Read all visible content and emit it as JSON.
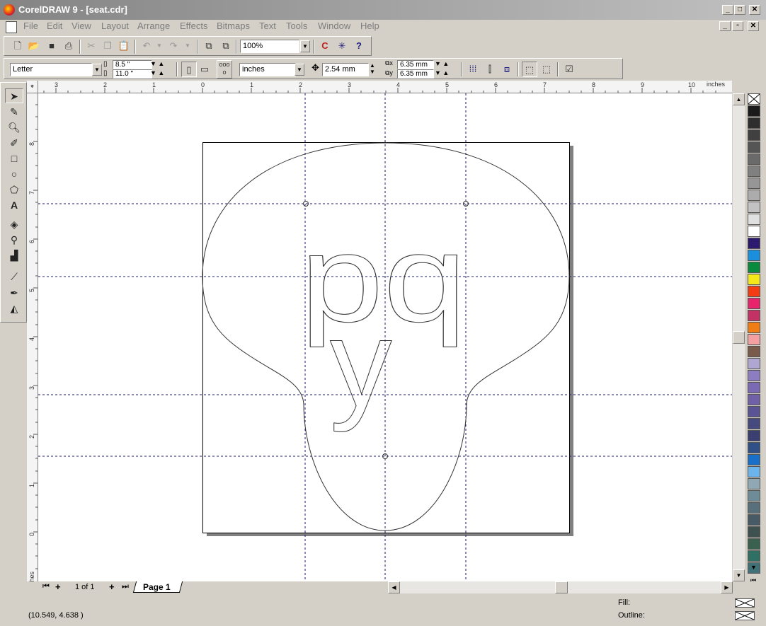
{
  "window": {
    "title": "CorelDRAW 9 - [seat.cdr]"
  },
  "menu": [
    "File",
    "Edit",
    "View",
    "Layout",
    "Arrange",
    "Effects",
    "Bitmaps",
    "Text",
    "Tools",
    "Window",
    "Help"
  ],
  "toolbar": {
    "zoom": "100%"
  },
  "property_bar": {
    "paper_size": "Letter",
    "width": "8.5 \"",
    "height": "11.0 \"",
    "units": "inches",
    "nudge": "2.54 mm",
    "dup_x": "6.35 mm",
    "dup_y": "6.35 mm"
  },
  "rulers": {
    "unit_label": "inches",
    "h_ticks": [
      "3",
      "2",
      "1",
      "0",
      "1",
      "2",
      "3",
      "4",
      "5",
      "6",
      "7",
      "8",
      "9",
      "10"
    ],
    "v_ticks": [
      "8",
      "7",
      "6",
      "5",
      "4",
      "3",
      "2",
      "1",
      "0"
    ]
  },
  "artwork": {
    "letters": "pqy"
  },
  "page_nav": {
    "count": "1 of 1",
    "tab": "Page 1"
  },
  "status": {
    "coords": "(10.549, 4.638 )",
    "fill_label": "Fill:",
    "outline_label": "Outline:"
  },
  "palette": [
    "#1a1a1a",
    "#2e2e2e",
    "#404040",
    "#555555",
    "#6a6a6a",
    "#808080",
    "#969696",
    "#acacac",
    "#c2c2c2",
    "#e0e0e0",
    "#ffffff",
    "#2b1a6e",
    "#1b8fdc",
    "#0a8a3c",
    "#f4e81a",
    "#f43c14",
    "#e8246c",
    "#c23264",
    "#f07c14",
    "#f4a0a0",
    "#7a5a4a",
    "#b0a6d2",
    "#8c7cc0",
    "#7a6ab4",
    "#7060a8",
    "#5a5494",
    "#464a7e",
    "#3a3e70",
    "#305088",
    "#1a70c8",
    "#6cb4ec",
    "#90a8b4",
    "#6e8c98",
    "#58707c",
    "#485a66",
    "#3e5050",
    "#3a6050",
    "#2e7064",
    "#407078"
  ]
}
